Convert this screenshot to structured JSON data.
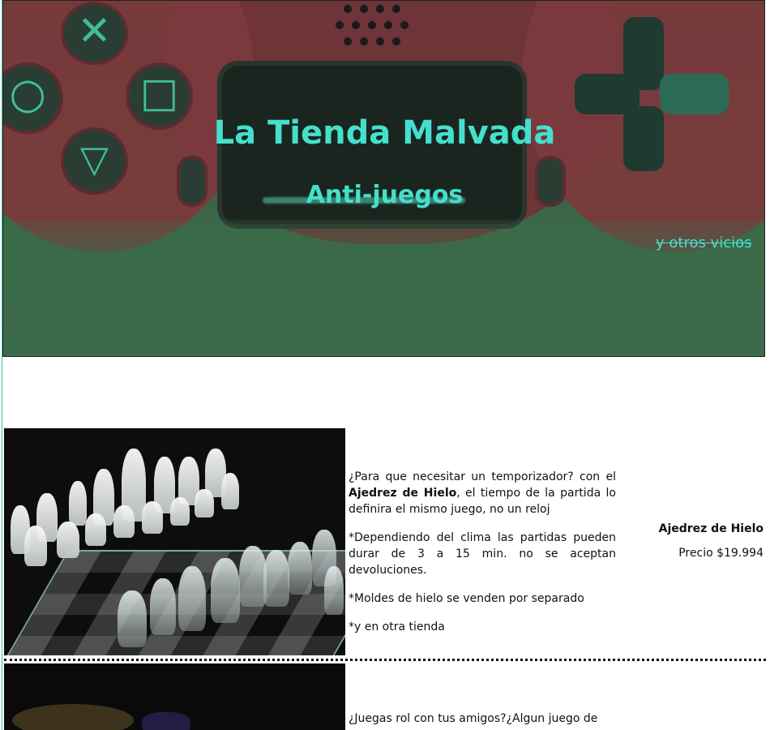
{
  "hero": {
    "title": "La Tienda Malvada",
    "subtitle": "Anti-juegos",
    "tagline": "y otros vicios"
  },
  "products": [
    {
      "name": "Ajedrez de Hielo",
      "price": "Precio $19.994",
      "image_alt": "ajedrez-de-cristal",
      "desc_1_pre": "¿Para que necesitar un temporizador? con el ",
      "desc_1_bold": "Ajedrez de Hielo",
      "desc_1_post": ", el tiempo de la partida lo definira el mismo juego, no un reloj",
      "desc_2": "*Dependiendo del clima las partidas pueden durar de 3 a 15 min. no se aceptan devoluciones.",
      "desc_3": "*Moldes de hielo se venden por separado",
      "desc_4": "*y en otra tienda"
    },
    {
      "desc_1_pre": "¿Juegas rol con tus amigos?¿Algun juego de"
    }
  ],
  "colors": {
    "accent": "#44e0cc",
    "hero_green": "#3b6a49",
    "controller_red": "#7a3a3c"
  }
}
